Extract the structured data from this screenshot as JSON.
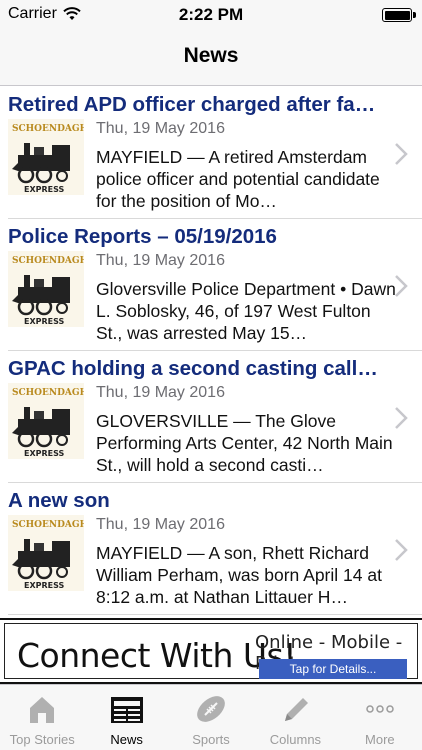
{
  "status_bar": {
    "carrier": "Carrier",
    "time": "2:22 PM"
  },
  "nav": {
    "title": "News"
  },
  "articles": [
    {
      "title": "Retired APD officer charged after fa…",
      "date": "Thu, 19 May 2016",
      "summary": "MAYFIELD — A retired Amsterdam police officer and potential candidate for the position of Mo…"
    },
    {
      "title": "Police Reports – 05/19/2016",
      "date": "Thu, 19 May 2016",
      "summary": "Gloversville Police Department • Dawn L. Soblosky, 46, of 197 West Fulton St., was arrested May 15…"
    },
    {
      "title": "GPAC holding a second casting call…",
      "date": "Thu, 19 May 2016",
      "summary": "GLOVERSVILLE — The Glove Performing Arts Center, 42 North Main St., will hold a second casti…"
    },
    {
      "title": "A new son",
      "date": "Thu, 19 May 2016",
      "summary": "MAYFIELD — A son, Rhett Richard William Perham, was born April 14 at 8:12 a.m. at Nathan Littauer H…"
    }
  ],
  "thumbnail": {
    "top_text": "SCHOENDAGH",
    "bottom_text": "EXPRESS"
  },
  "banner": {
    "title": "Connect With Us!",
    "right_text": "Online - Mobile - Print",
    "cta": "Tap for Details..."
  },
  "tabs": [
    {
      "label": "Top Stories",
      "icon": "house-icon"
    },
    {
      "label": "News",
      "icon": "newspaper-icon"
    },
    {
      "label": "Sports",
      "icon": "football-icon"
    },
    {
      "label": "Columns",
      "icon": "pencil-icon"
    },
    {
      "label": "More",
      "icon": "more-dots-icon"
    }
  ],
  "colors": {
    "title": "#142c7c",
    "active_tab": "#000000",
    "inactive_tab": "#9b9b9b"
  }
}
